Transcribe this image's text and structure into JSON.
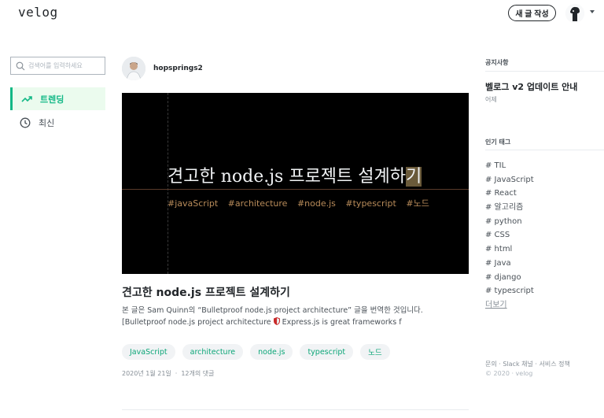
{
  "header": {
    "logo": "velog",
    "new_post_label": "새 글 작성"
  },
  "sidebar": {
    "search_placeholder": "검색어를 입력하세요",
    "nav": [
      {
        "label": "트렌딩",
        "icon": "trending-icon",
        "active": true
      },
      {
        "label": "최신",
        "icon": "clock-icon",
        "active": false
      }
    ]
  },
  "post": {
    "author": "hopsprings2",
    "thumbnail": {
      "title": "견고한 node.js 프로젝트 설계하",
      "cursor_char": "기",
      "tags": [
        "#javaScript",
        "#architecture",
        "#node.js",
        "#typescript",
        "#노드"
      ]
    },
    "title": "견고한 node.js 프로젝트 설계하기",
    "description_before": "본 글은 Sam Quinn의 “Bulletproof node.js project architecture” 글을 번역한 것입니다. [Bulletproof node.js project architecture ",
    "description_after": " Express.js is great frameworks f",
    "tags": [
      "JavaScript",
      "architecture",
      "node.js",
      "typescript",
      "노드"
    ],
    "date": "2020년 1월 21일",
    "comments": "12개의 댓글"
  },
  "right": {
    "notice_heading": "공지사항",
    "notice_title": "벨로그 v2 업데이트 안내",
    "notice_date": "어제",
    "tags_heading": "인기 태그",
    "popular_tags": [
      "# TIL",
      "# JavaScript",
      "# React",
      "# 알고리즘",
      "# python",
      "# CSS",
      "# html",
      "# Java",
      "# django",
      "# typescript"
    ],
    "more_label": "더보기",
    "footer_links": "문의 · Slack 채널 · 서비스 정책",
    "footer_copy": "© 2020 · velog"
  },
  "colors": {
    "accent": "#12b886",
    "tag_text": "#0ca678",
    "thumb_bg": "#000000",
    "thumb_tag": "#b98c5a"
  }
}
